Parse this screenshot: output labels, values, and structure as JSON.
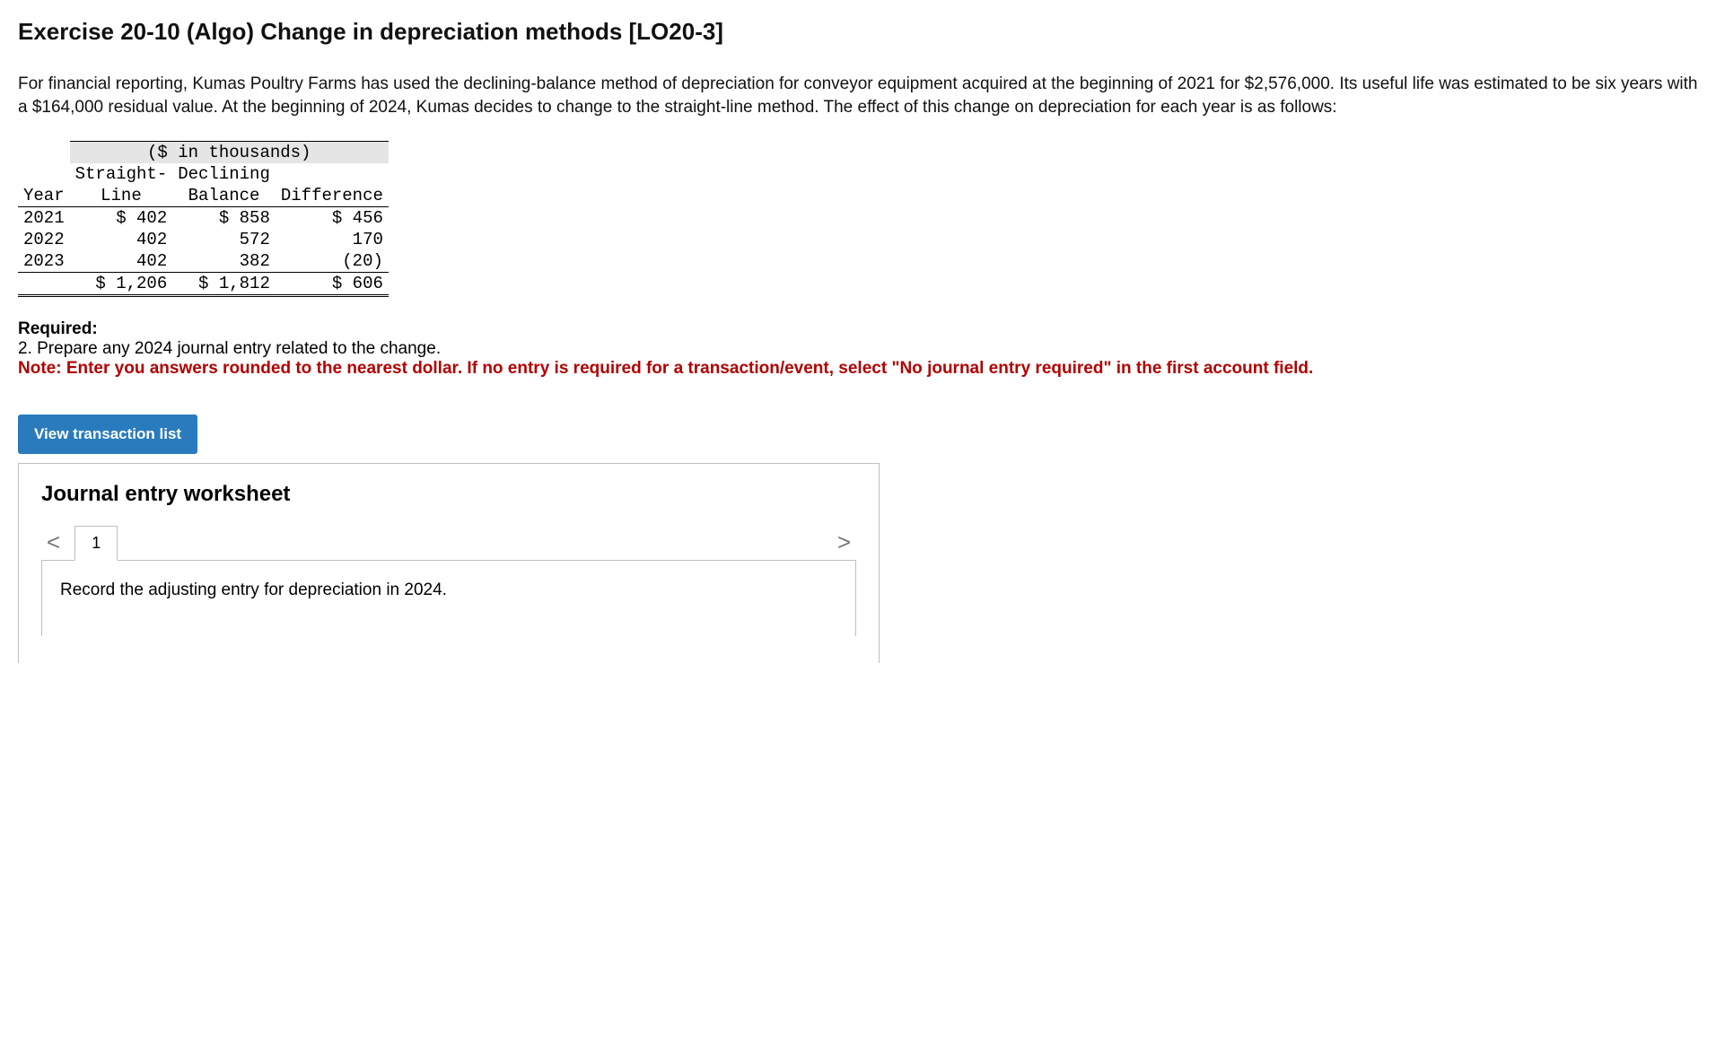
{
  "title": "Exercise 20-10 (Algo) Change in depreciation methods [LO20-3]",
  "intro": "For financial reporting, Kumas Poultry Farms has used the declining-balance method of depreciation for conveyor equipment acquired at the beginning of 2021 for $2,576,000. Its useful life was estimated to be six years with a $164,000 residual value. At the beginning of 2024, Kumas decides to change to the straight-line method. The effect of this change on depreciation for each year is as follows:",
  "table": {
    "units": "($ in thousands)",
    "headers": {
      "year": "Year",
      "sl1": "Straight-",
      "sl2": "Line",
      "db1": "Declining",
      "db2": "Balance",
      "diff": "Difference"
    },
    "rows": [
      {
        "year": "2021",
        "sl": "$ 402",
        "db": "$ 858",
        "diff": "$ 456"
      },
      {
        "year": "2022",
        "sl": "402",
        "db": "572",
        "diff": "170"
      },
      {
        "year": "2023",
        "sl": "402",
        "db": "382",
        "diff": "(20)"
      }
    ],
    "totals": {
      "sl": "$ 1,206",
      "db": "$ 1,812",
      "diff": "$ 606"
    }
  },
  "required": {
    "label": "Required:",
    "text": "2. Prepare any 2024 journal entry related to the change.",
    "note": "Note: Enter you answers rounded to the nearest dollar. If no entry is required for a transaction/event, select \"No journal entry required\" in the first account field."
  },
  "view_btn": "View transaction list",
  "worksheet": {
    "title": "Journal entry worksheet",
    "prev": "<",
    "next": ">",
    "tab": "1",
    "instruction": "Record the adjusting entry for depreciation in 2024."
  }
}
